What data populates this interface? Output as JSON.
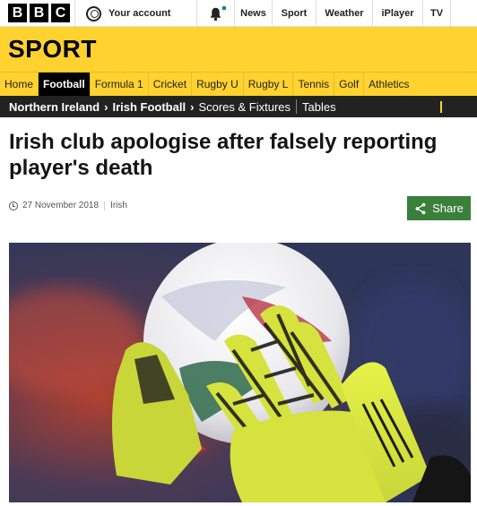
{
  "topbar": {
    "logo_letters": [
      "B",
      "B",
      "C"
    ],
    "account_label": "Your account",
    "nav_links": [
      "News",
      "Sport",
      "Weather",
      "iPlayer",
      "TV"
    ]
  },
  "sport_header": {
    "title": "SPORT"
  },
  "sport_nav": {
    "items": [
      "Home",
      "Football",
      "Formula 1",
      "Cricket",
      "Rugby U",
      "Rugby L",
      "Tennis",
      "Golf",
      "Athletics"
    ],
    "active": "Football"
  },
  "sub_nav": {
    "breadcrumb_1": "Northern Ireland",
    "breadcrumb_2": "Irish Football",
    "link_scores": "Scores & Fixtures",
    "link_tables": "Tables"
  },
  "article": {
    "headline": "Irish club apologise after falsely reporting player's death",
    "date": "27 November 2018",
    "section": "Irish",
    "share_label": "Share"
  },
  "colors": {
    "sport_yellow": "#ffd230",
    "share_green": "#3a7f3a",
    "subnav_dark": "#222222"
  },
  "icons": [
    "account-icon",
    "bell-icon",
    "clock-icon",
    "share-icon"
  ]
}
